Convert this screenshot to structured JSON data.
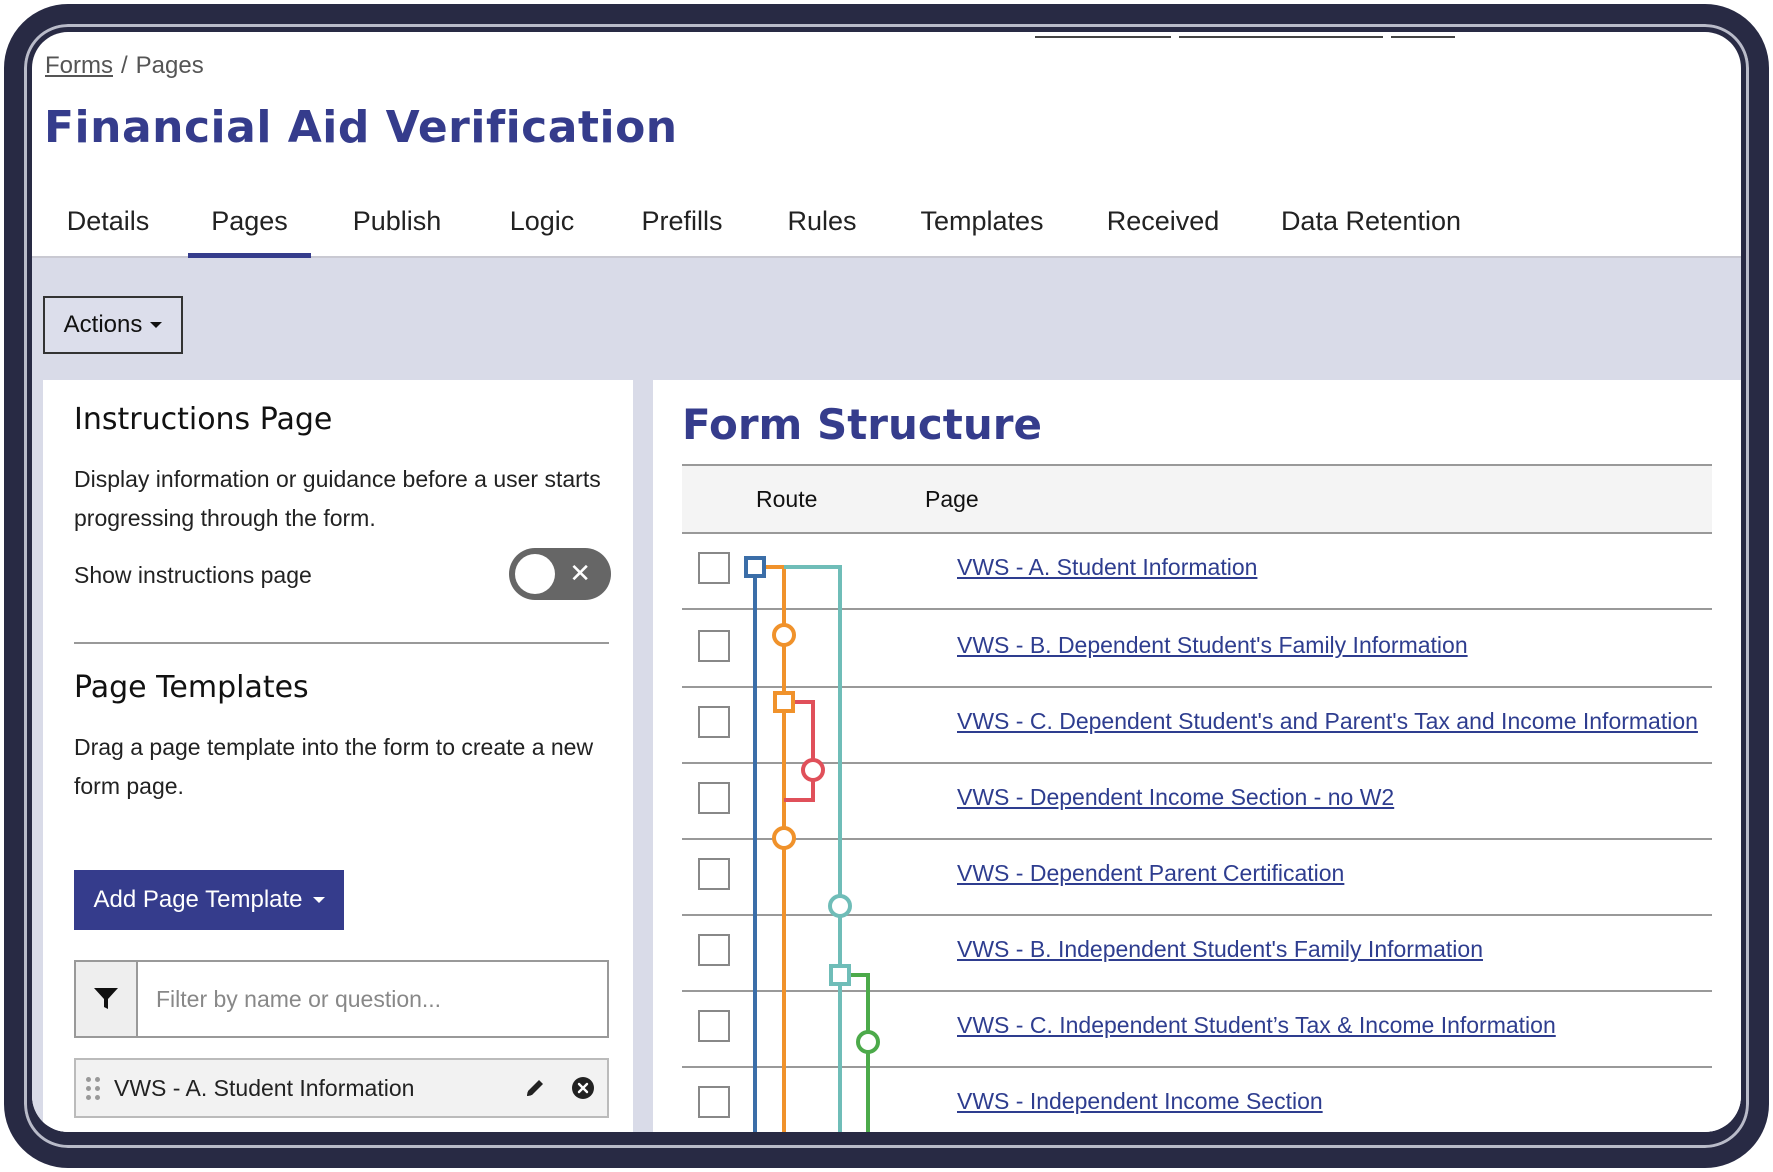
{
  "breadcrumb": {
    "forms": "Forms",
    "separator": "/",
    "current": "Pages"
  },
  "page_title": "Financial Aid Verification",
  "tabs": [
    {
      "label": "Details"
    },
    {
      "label": "Pages",
      "active": true
    },
    {
      "label": "Publish"
    },
    {
      "label": "Logic"
    },
    {
      "label": "Prefills"
    },
    {
      "label": "Rules"
    },
    {
      "label": "Templates"
    },
    {
      "label": "Received"
    },
    {
      "label": "Data Retention"
    }
  ],
  "actions": {
    "label": "Actions"
  },
  "instructions": {
    "heading": "Instructions Page",
    "description": "Display information or guidance before a user starts progressing through the form.",
    "toggle_label": "Show instructions page",
    "toggle_on": false
  },
  "templates": {
    "heading": "Page Templates",
    "description": "Drag a page template into the form to create a new form page.",
    "add_button": "Add Page Template",
    "filter_placeholder": "Filter by name or question...",
    "items": [
      {
        "name": "VWS - A. Student Information"
      }
    ]
  },
  "form_structure": {
    "title": "Form Structure",
    "columns": {
      "route": "Route",
      "page": "Page"
    },
    "rows": [
      {
        "page": "VWS - A. Student Information"
      },
      {
        "page": "VWS - B. Dependent Student's Family Information"
      },
      {
        "page": "VWS - C. Dependent Student's and Parent's Tax and Income Information"
      },
      {
        "page": "VWS - Dependent Income Section - no W2"
      },
      {
        "page": "VWS - Dependent Parent Certification"
      },
      {
        "page": "VWS - B. Independent Student's Family Information"
      },
      {
        "page": "VWS - C. Independent Student’s Tax & Income Information"
      },
      {
        "page": "VWS - Independent Income Section"
      }
    ]
  },
  "colors": {
    "brand": "#353c8c",
    "route_blue": "#3b6ea8",
    "route_orange": "#f0922b",
    "route_teal": "#6fbdb8",
    "route_red": "#e0505a",
    "route_green": "#4caa4a",
    "band": "#d9dbe8"
  },
  "icons": {
    "actions_caret": "chevron-down-icon",
    "add_caret": "chevron-down-icon",
    "filter": "filter-icon",
    "drag": "drag-handle-icon",
    "edit": "pencil-icon",
    "remove": "close-circle-icon",
    "toggle_off": "close-icon"
  }
}
